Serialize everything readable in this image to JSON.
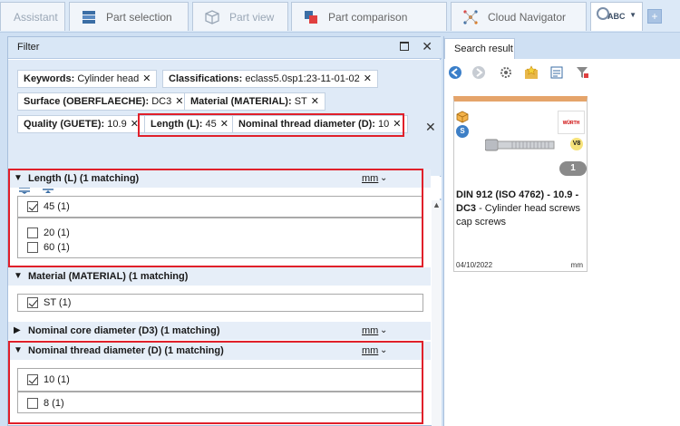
{
  "tabs": {
    "assistant": "Assistant",
    "part_selection": "Part selection",
    "part_view": "Part view",
    "part_comparison": "Part comparison",
    "cloud_navigator": "Cloud Navigator",
    "abc_label": "ABC",
    "plus": "+"
  },
  "filter": {
    "title": "Filter",
    "chips": [
      {
        "key": "Keywords:",
        "value": "Cylinder head"
      },
      {
        "key": "Classifications:",
        "value": "eclass5.0sp1:23-11-01-02"
      },
      {
        "key": "Surface (OBERFLAECHE):",
        "value": "DC3"
      },
      {
        "key": "Material (MATERIAL):",
        "value": "ST"
      },
      {
        "key": "Quality (GUETE):",
        "value": "10.9"
      },
      {
        "key": "Length (L):",
        "value": "45"
      },
      {
        "key": "Nominal thread diameter (D):",
        "value": "10"
      }
    ],
    "chip_remove": "✕",
    "groups": {
      "length": {
        "title": "Length (L) (1 matching)",
        "unit": "mm",
        "options": [
          "45 (1)",
          "20 (1)",
          "60 (1)"
        ]
      },
      "material": {
        "title": "Material (MATERIAL) (1 matching)",
        "options": [
          "ST (1)"
        ]
      },
      "core": {
        "title": "Nominal core diameter (D3) (1 matching)",
        "unit": "mm"
      },
      "thread": {
        "title": "Nominal thread diameter (D) (1 matching)",
        "unit": "mm",
        "options": [
          "10 (1)",
          "8 (1)"
        ]
      }
    }
  },
  "result": {
    "tab_label": "Search result",
    "card": {
      "title_bold": "DIN 912 (ISO 4762) - 10.9 - DC3",
      "title_rest": " - Cylinder head screws cap screws",
      "date": "04/10/2022",
      "unit": "mm",
      "count": "1",
      "brand": "WÜRTH",
      "variant": "V8",
      "s_badge": "S"
    }
  },
  "colors": {
    "highlight_border": "#e0202a",
    "card_top": "#e5a46a",
    "panel_header": "#d9e7f6"
  }
}
